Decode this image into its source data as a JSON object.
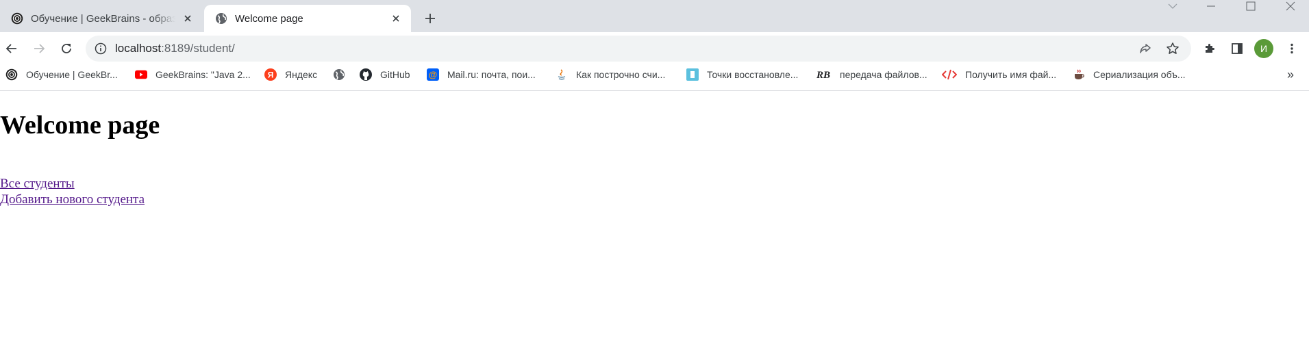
{
  "tabs": [
    {
      "title": "Обучение | GeekBrains - образовательный портал",
      "active": false
    },
    {
      "title": "Welcome page",
      "active": true
    }
  ],
  "address_bar": {
    "host": "localhost",
    "rest": ":8189/student/"
  },
  "profile": {
    "initial": "И",
    "color": "#5a9a38"
  },
  "bookmarks": [
    {
      "label": "Обучение | GeekBr...",
      "icon": "geekbrains-icon"
    },
    {
      "label": "GeekBrains: \"Java 2...",
      "icon": "youtube-icon"
    },
    {
      "label": "Яндекс",
      "icon": "yandex-icon"
    },
    {
      "label": "",
      "icon": "globe-icon"
    },
    {
      "label": "GitHub",
      "icon": "github-icon"
    },
    {
      "label": "Mail.ru: почта, пои...",
      "icon": "mailru-icon"
    },
    {
      "label": "Как построчно счи...",
      "icon": "java-icon"
    },
    {
      "label": "Точки восстановле...",
      "icon": "bookmark-icon"
    },
    {
      "label": "передача файлов...",
      "icon": "rb-icon"
    },
    {
      "label": "Получить имя фай...",
      "icon": "code-icon"
    },
    {
      "label": "Сериализация объ...",
      "icon": "java-cup-icon"
    }
  ],
  "page": {
    "heading": "Welcome page",
    "links": [
      "Все студенты",
      "Добавить нового студента"
    ]
  }
}
